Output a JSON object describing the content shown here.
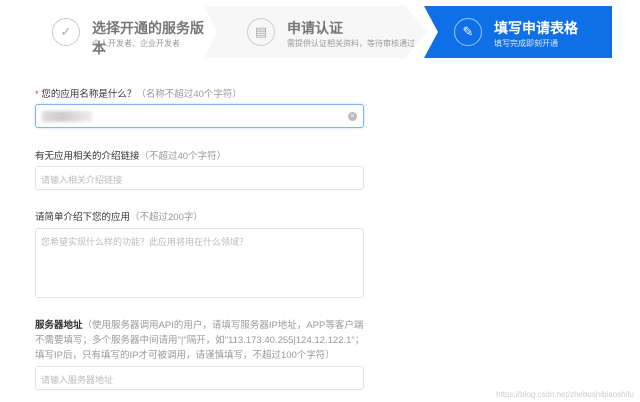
{
  "steps": [
    {
      "title": "选择开通的服务版本",
      "desc": "个人开发者、企业开发者",
      "icon": "check-icon"
    },
    {
      "title": "申请认证",
      "desc": "需提供认证相关资料，等待审核通过",
      "icon": "document-icon"
    },
    {
      "title": "填写申请表格",
      "desc": "填写完成即刻开通",
      "icon": "pencil-icon"
    }
  ],
  "form": {
    "name": {
      "required": "*",
      "label": "您的应用名称是什么？",
      "hint": "（名称不超过40个字符）"
    },
    "link": {
      "label": "有无应用相关的介绍链接",
      "hint": "（不超过40个字符）",
      "placeholder": "请输入相关介绍链接"
    },
    "intro": {
      "label": "请简单介绍下您的应用",
      "hint": "（不超过200字）",
      "placeholder": "您希望实现什么样的功能？此应用将用在什么领域？"
    },
    "server": {
      "label": "服务器地址",
      "hint": "（使用服务器调用API的用户，请填写服务器IP地址，APP等客户端不需要填写；多个服务器中间请用\"|\"隔开，如\"113.173.40.255|124.12.122.1\"；填写IP后，只有填写的IP才可被调用，请谨慎填写，不超过100个字符）",
      "placeholder": "请输入服务器地址"
    }
  },
  "watermark": "https://blog.csdn.net/zhebushibiaoshifu"
}
